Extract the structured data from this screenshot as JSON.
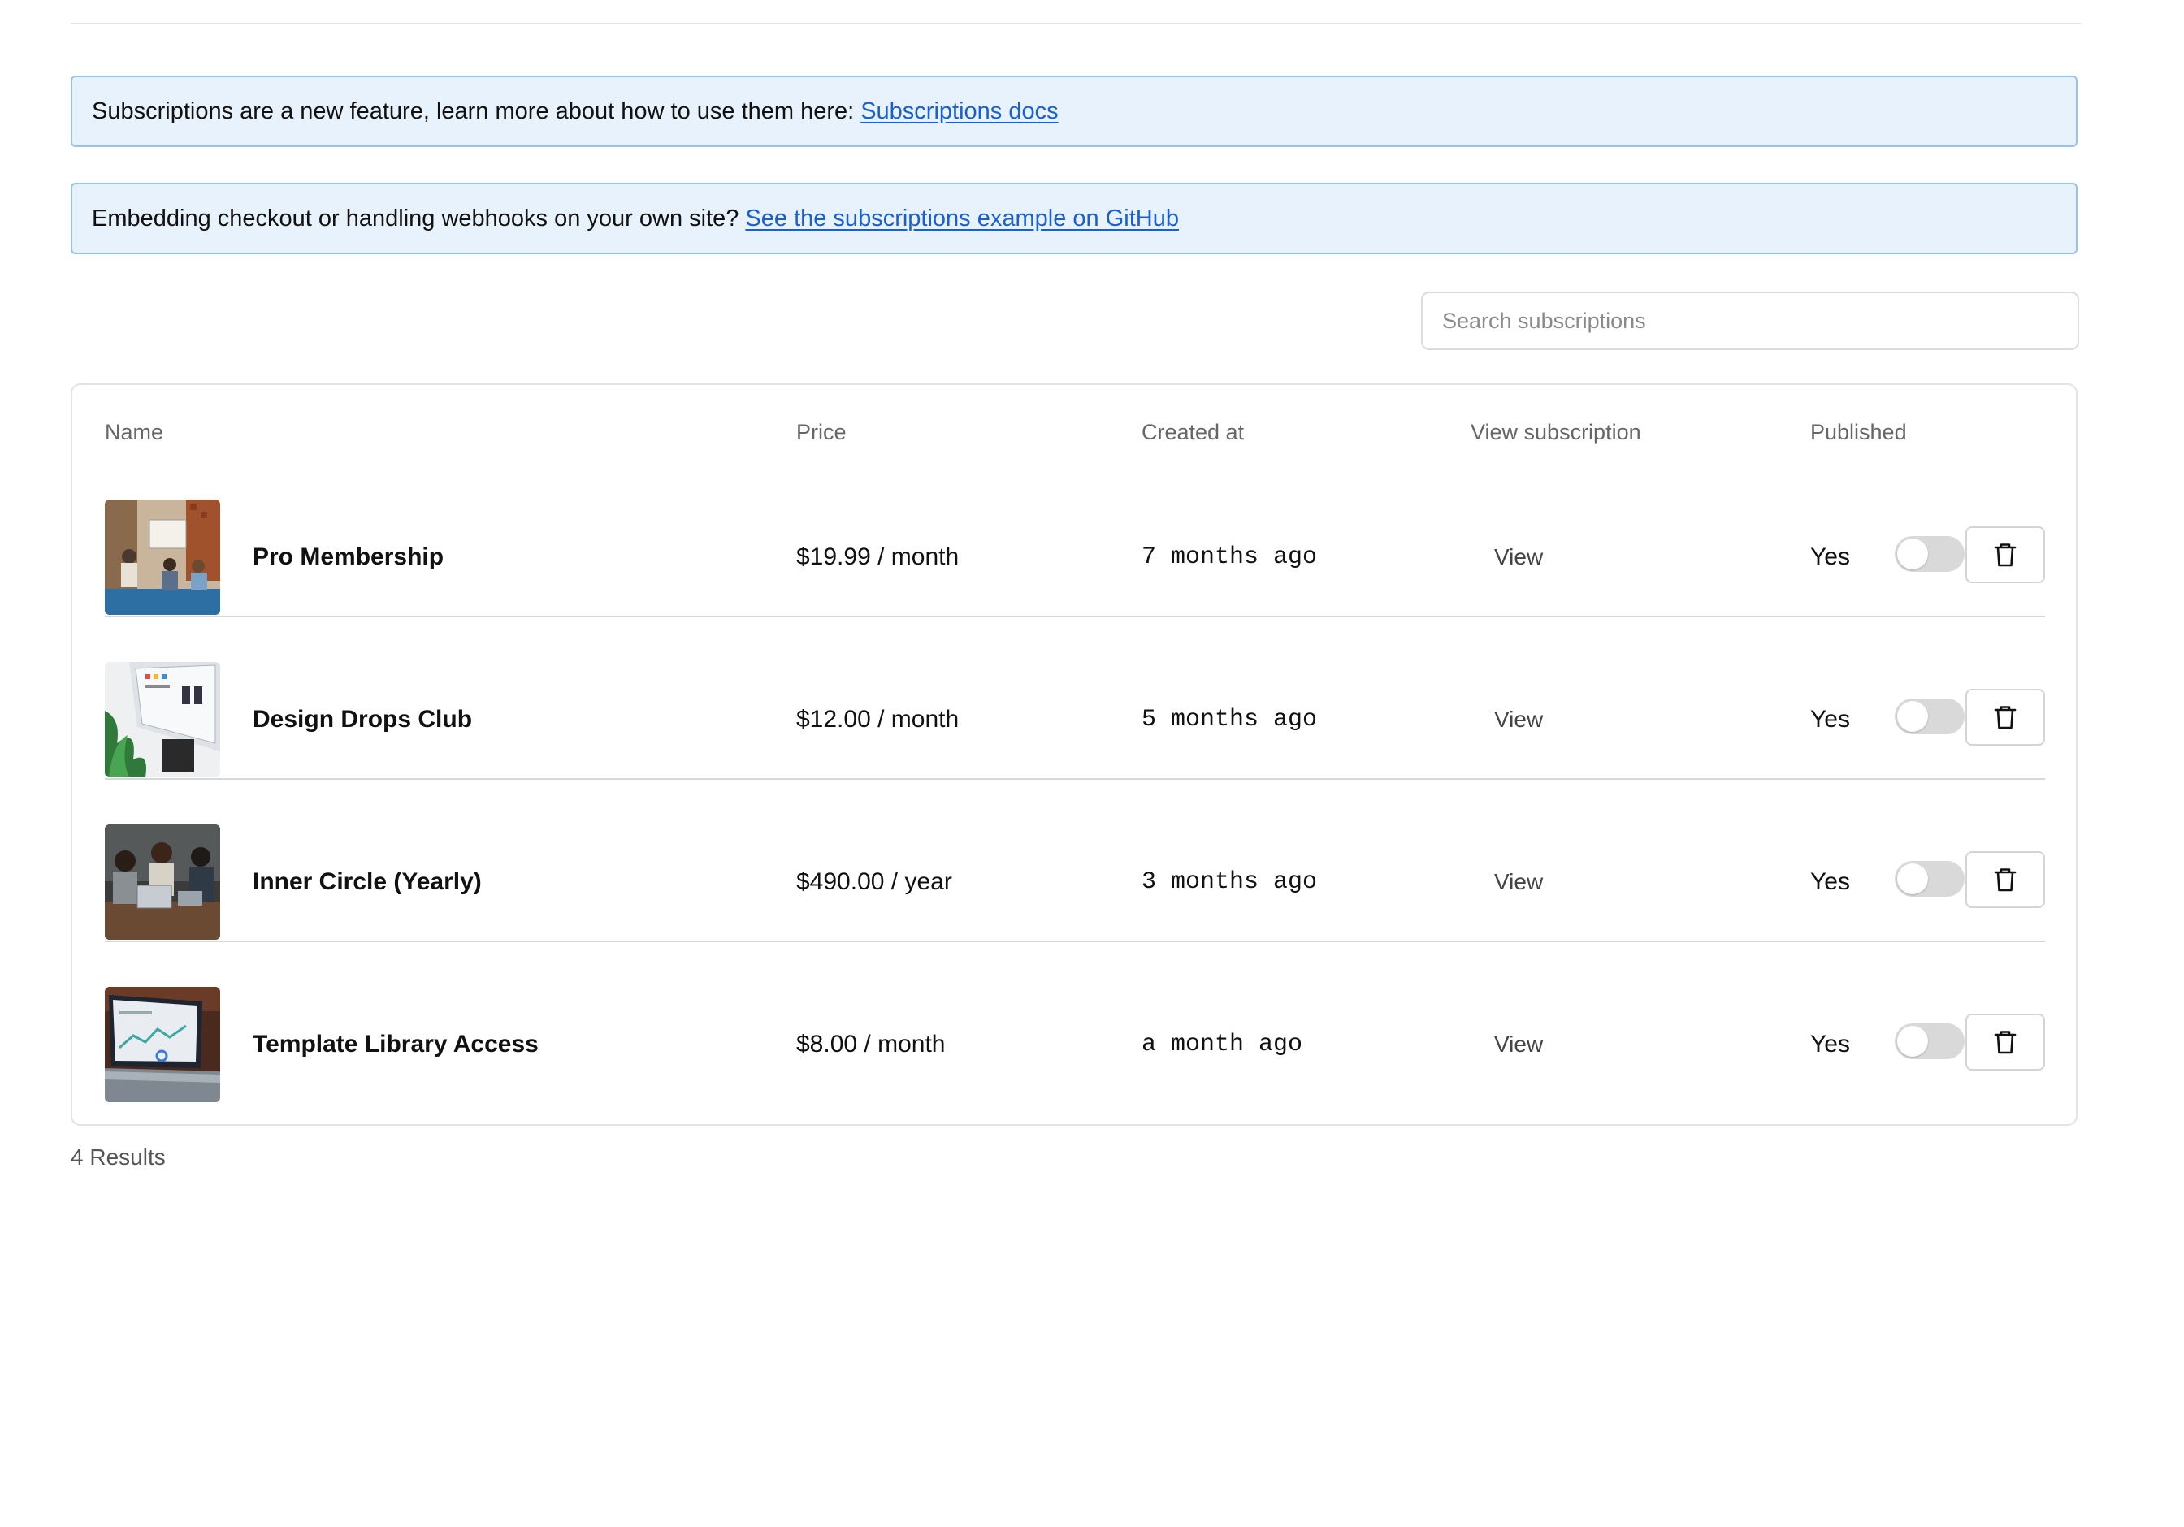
{
  "notices": [
    {
      "text": "Subscriptions are a new feature, learn more about how to use them here:",
      "link": "Subscriptions docs"
    },
    {
      "text": "Embedding checkout or handling webhooks on your own site?",
      "link": "See the subscriptions example on GitHub"
    }
  ],
  "search": {
    "placeholder": "Search subscriptions",
    "value": ""
  },
  "table": {
    "headers": {
      "name": "Name",
      "price": "Price",
      "created": "Created at",
      "view": "View subscription",
      "published": "Published"
    },
    "rows": [
      {
        "name": "Pro Membership",
        "price": "$19.99 / month",
        "created": "7 months ago",
        "view": "View",
        "published": "Yes",
        "published_on": false
      },
      {
        "name": "Design Drops Club",
        "price": "$12.00 / month",
        "created": "5 months ago",
        "view": "View",
        "published": "Yes",
        "published_on": false
      },
      {
        "name": "Inner Circle (Yearly)",
        "price": "$490.00 / year",
        "created": "3 months ago",
        "view": "View",
        "published": "Yes",
        "published_on": false
      },
      {
        "name": "Template Library Access",
        "price": "$8.00 / month",
        "created": "a month ago",
        "view": "View",
        "published": "Yes",
        "published_on": false
      }
    ]
  },
  "footer": {
    "results": "4 Results"
  },
  "colors": {
    "notice_bg": "#e8f2fc",
    "notice_border": "#93c3ee",
    "link": "#1a5fd0",
    "toggle_off": "#d9d9d9"
  },
  "icons": {
    "delete": "trash-icon"
  }
}
